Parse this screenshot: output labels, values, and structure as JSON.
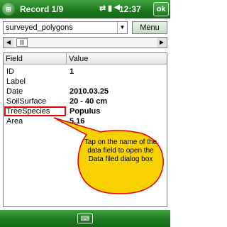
{
  "app": {
    "title": "Record 1/9",
    "clock": "12:37",
    "ok_label": "ok",
    "icons": [
      "windows-start-icon",
      "network-icon",
      "signal-icon",
      "volume-icon"
    ]
  },
  "layer": {
    "selected": "surveyed_polygons",
    "menu_label": "Menu"
  },
  "table": {
    "headers": [
      "Field",
      "Value"
    ],
    "rows": [
      {
        "field": "ID",
        "value": "1"
      },
      {
        "field": "Label",
        "value": ""
      },
      {
        "field": "Date",
        "value": "2010.03.25"
      },
      {
        "field": "SoilSurface",
        "value": "20 - 40 cm"
      },
      {
        "field": "TreeSpecies",
        "value": "Populus"
      },
      {
        "field": "Area",
        "value": "5.16"
      }
    ]
  },
  "callout": {
    "text": "Tap on the name of the data field to open the Data filed dialog box"
  },
  "colors": {
    "bar_green": "#1d7a1d",
    "highlight_red": "#e60000",
    "callout_fill": "#f7d200"
  }
}
